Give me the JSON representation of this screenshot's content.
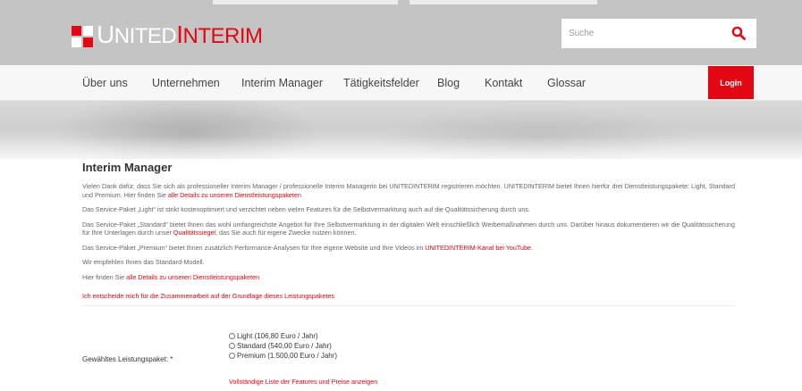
{
  "header": {
    "logo": {
      "part1": "U",
      "part2": "NITED",
      "part3": "I",
      "part4": "NTERIM"
    },
    "search": {
      "placeholder": "Suche",
      "icon": "search-icon"
    }
  },
  "nav": {
    "items": [
      "Über uns",
      "Unternehmen",
      "Interim Manager",
      "Tätigkeitsfelder",
      "Blog",
      "Kontakt",
      "Glossar"
    ],
    "login_label": "Login"
  },
  "main": {
    "title": "Interim Manager",
    "p1_text": "Vielen Dank dafür, dass Sie sich als professioneller Interim Manager / professionelle Interim Managerin bei UNITEDINTERIM registrieren möchten. UNITEDINTERIM bietet Ihnen hierfür drei Dienstleistungspakete: Light, Standard und Premium. Hier finden Sie ",
    "p1_link": "alle Details zu unseren Dienstleistungspaketen",
    "p2_text": "Das Service-Paket „Light“ ist strikt kostenoptimiert und verzichtet neben vielen Features für die Selbstvermarktung auch auf die Qualitätssicherung durch uns.",
    "p3_text": "Das Service-Paket „Standard“ bietet Ihnen das wohl umfangreichste Angebot für Ihre Selbstvermarktung in der digitalen Welt einschließlich Werbemaßnahmen durch uns. Darüber hinaus dokumentieren wir die Qualitätssicherung für Ihre Unterlagen durch unser ",
    "p3_link": "Qualitätssiegel",
    "p3_text_end": ", das Sie auch für eigene Zwecke nutzen können.",
    "p4_text": "Das Service-Paket „Premium“ bietet Ihnen zusätzlich Performance-Analysen für Ihre eigene Website und Ihre Videos im ",
    "p4_link": "UNITEDINTERIM-Kanal bei YouTube",
    "p4_end": ".",
    "p5_text": "Wir empfehlen Ihnen das Standard-Modell.",
    "p6_text": "Hier finden Sie ",
    "p6_link": "alle Details zu unseren Dienstleistungspaketen",
    "agree_link": "Ich entscheide mich für die Zusammenarbeit auf der Grundlage dieses Leistungspaketes"
  },
  "form": {
    "label": "Gewähltes Leistungspaket: *",
    "options": [
      "Light (106,80 Euro / Jahr)",
      "Standard (540,00 Euro / Jahr)",
      "Premium (1.500,00 Euro / Jahr)"
    ],
    "full_list_link": "Vollständige Liste der Features und Preise anzeigen"
  },
  "colors": {
    "accent": "#e30613",
    "header_bg": "#c4c4c4",
    "nav_bg": "#f7f7f7"
  }
}
